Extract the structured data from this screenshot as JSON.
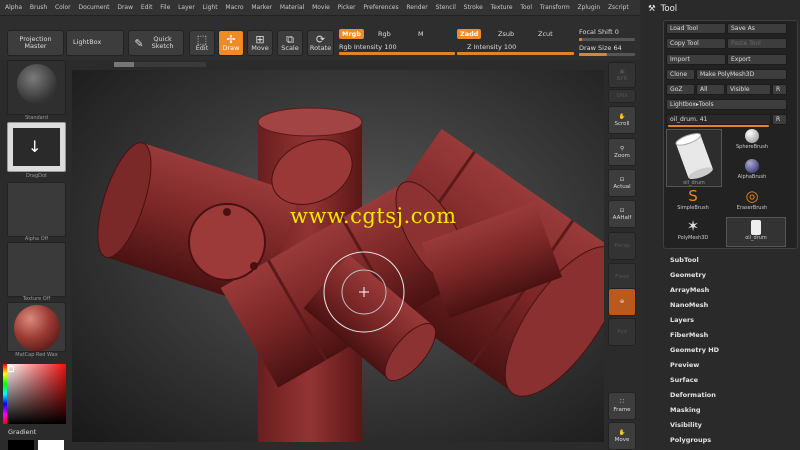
{
  "menu": [
    "Alpha",
    "Brush",
    "Color",
    "Document",
    "Draw",
    "Edit",
    "File",
    "Layer",
    "Light",
    "Macro",
    "Marker",
    "Material",
    "Movie",
    "Picker",
    "Preferences",
    "Render",
    "Stencil",
    "Stroke",
    "Texture",
    "Tool",
    "Transform",
    "Zplugin",
    "Zscript"
  ],
  "toolbar": {
    "projection_master": "Projection Master",
    "lightbox": "LightBox",
    "quick_sketch": "Quick Sketch",
    "edit": "Edit",
    "draw": "Draw",
    "move": "Move",
    "scale": "Scale",
    "rotate": "Rotate",
    "mrgb": "Mrgb",
    "rgb": "Rgb",
    "m": "M",
    "zadd": "Zadd",
    "zsub": "Zsub",
    "zcut": "Zcut",
    "rgb_intensity": "Rgb Intensity 100",
    "z_intensity": "Z Intensity 100",
    "focal_shift": "Focal Shift 0",
    "draw_size": "Draw Size 64",
    "rgb_intensity_value": 100,
    "z_intensity_value": 100,
    "focal_shift_value": 0,
    "draw_size_value": 64
  },
  "left_shelf": {
    "brush_label": "Standard",
    "stroke_label": "DragDot",
    "alpha_label": "Alpha Off",
    "texture_label": "Texture Off",
    "material_label": "MatCap Red Wax",
    "gradient_label": "Gradient"
  },
  "watermark": "www.cgtsj.com",
  "right_shelf": {
    "bpr": "BPR",
    "spix": "SPix",
    "scroll": "Scroll",
    "zoom": "Zoom",
    "actual": "Actual",
    "aahalf": "AAHalf",
    "persp": "Persp",
    "floor": "Floor",
    "local": "Local",
    "xyz": "Xyz",
    "frame": "Frame",
    "move": "Move"
  },
  "tool_panel": {
    "title": "Tool",
    "load_tool": "Load Tool",
    "save_as": "Save As",
    "copy_tool": "Copy Tool",
    "paste_tool": "Paste Tool",
    "import": "Import",
    "export": "Export",
    "clone": "Clone",
    "make_polymesh": "Make PolyMesh3D",
    "goz": "GoZ",
    "all": "All",
    "visible": "Visible",
    "r": "R",
    "lightbox_tools": "Lightbox▸Tools",
    "current_tool": "oil_drum. 41",
    "current_tool_value": 41,
    "thumbs": [
      "oil_drum",
      "SphereBrush",
      "AlphaBrush",
      "SimpleBrush",
      "EraserBrush",
      "PolyMesh3D",
      "oil_drum"
    ],
    "sub_items": [
      "SubTool",
      "Geometry",
      "ArrayMesh",
      "NanoMesh",
      "Layers",
      "FiberMesh",
      "Geometry HD",
      "Preview",
      "Surface",
      "Deformation",
      "Masking",
      "Visibility",
      "Polygroups"
    ]
  },
  "colors": {
    "accent": "#ee8a2a",
    "model": "#8a2f2f"
  }
}
